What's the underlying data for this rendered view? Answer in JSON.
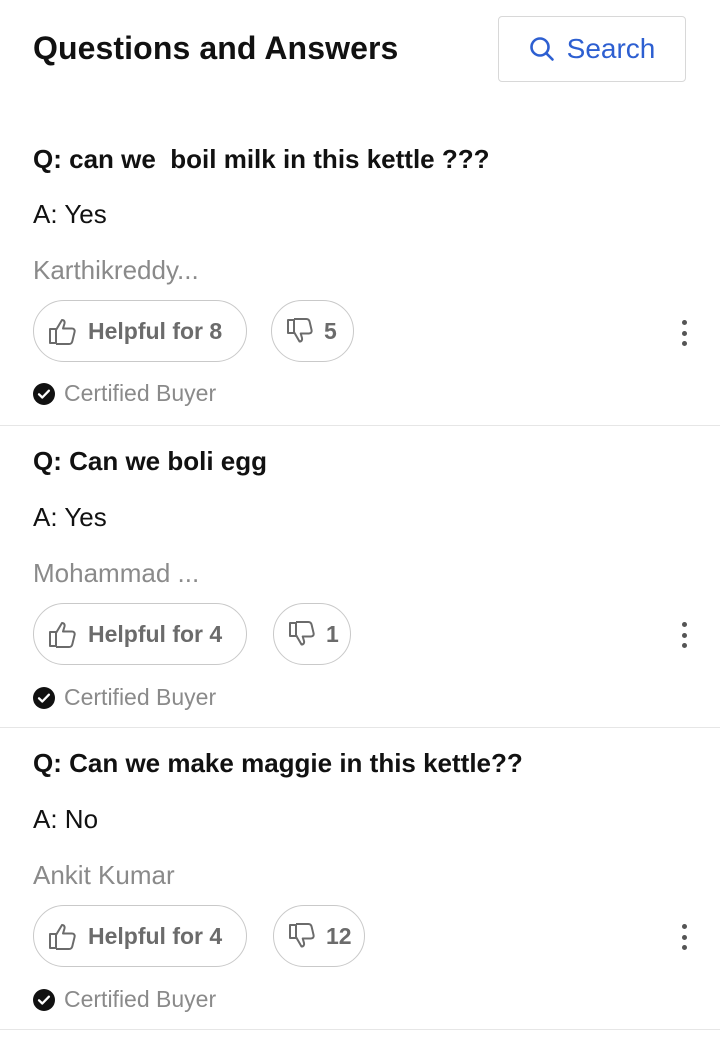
{
  "header": {
    "title": "Questions and Answers",
    "search_label": "Search",
    "search_icon": "search-icon",
    "accent_color": "#2d5fd1"
  },
  "questions": [
    {
      "question": "Q: can we  boil milk in this kettle ???",
      "answer": "A: Yes",
      "author": "Karthikreddy...",
      "helpful_label": "Helpful for 8",
      "unhelpful_count": "5",
      "badge": "Certified Buyer"
    },
    {
      "question": "Q: Can we boli egg",
      "answer": "A: Yes",
      "author": "Mohammad ...",
      "helpful_label": "Helpful for 4",
      "unhelpful_count": "1",
      "badge": "Certified Buyer"
    },
    {
      "question": "Q: Can we make maggie in this kettle??",
      "answer": "A: No",
      "author": "Ankit Kumar",
      "helpful_label": "Helpful for 4",
      "unhelpful_count": "12",
      "badge": "Certified Buyer"
    }
  ]
}
